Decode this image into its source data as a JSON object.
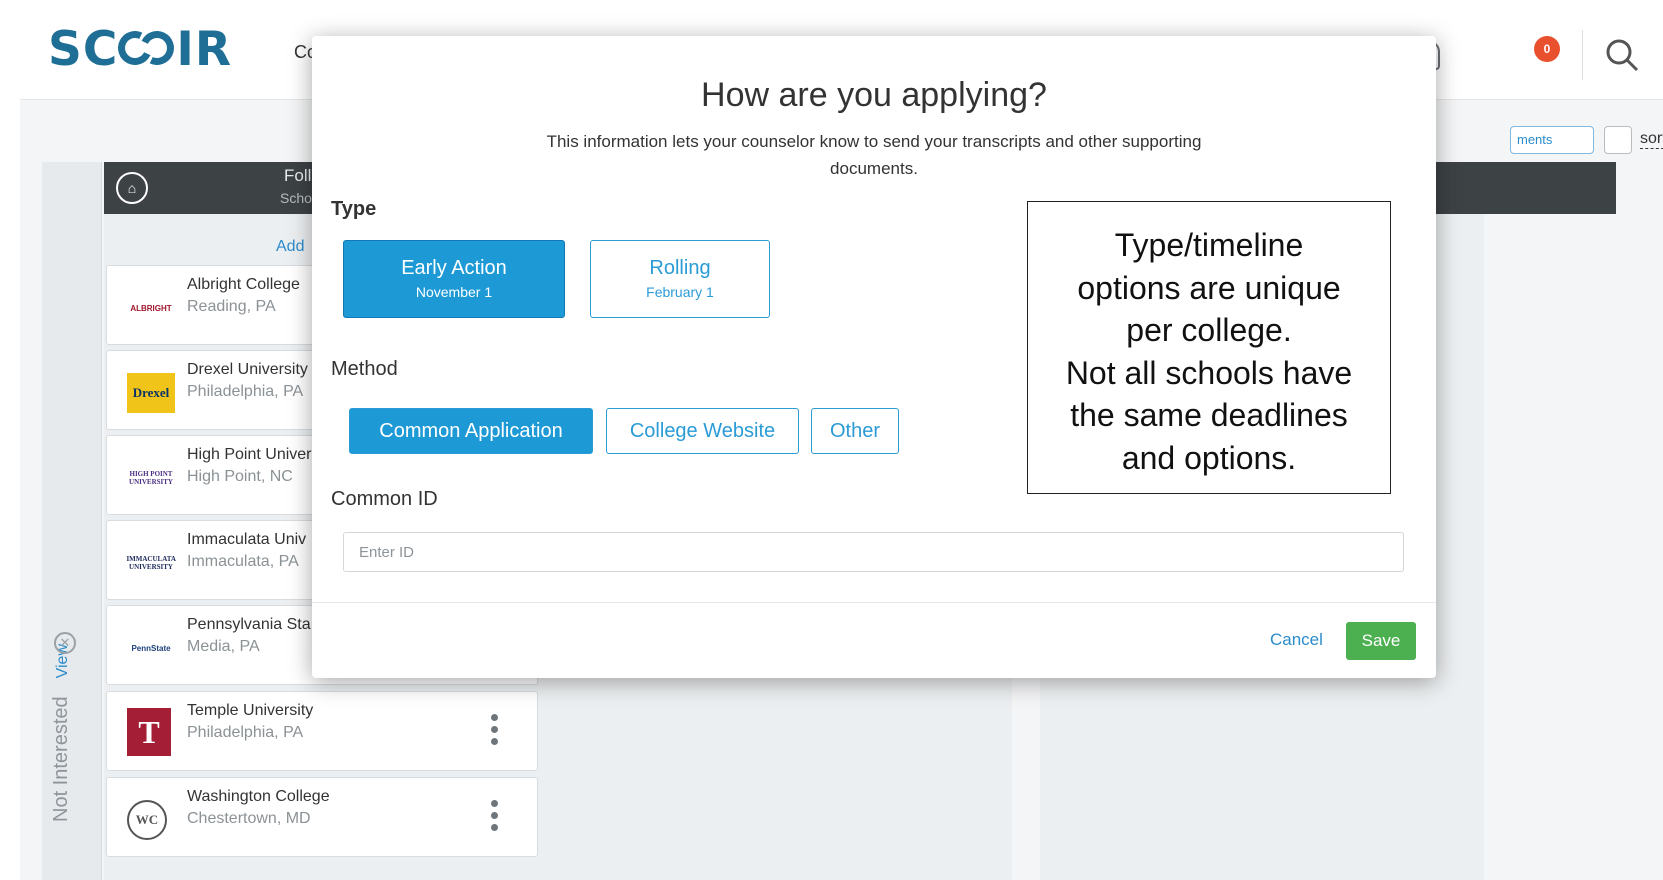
{
  "nav": {
    "logo_text": "SCOIR",
    "college_label": "Coll",
    "notification_count": "0"
  },
  "toolbar": {
    "ments_label": "ments",
    "sort_label": "sort b"
  },
  "sidebar": {
    "label": "Not Interested",
    "view_label": "View"
  },
  "list": {
    "header_title": "Foll",
    "header_sub": "Scho",
    "add_label": "Add",
    "colleges": [
      {
        "name": "Albright College",
        "location": "Reading, PA",
        "logo": "ALBRIGHT"
      },
      {
        "name": "Drexel University",
        "location": "Philadelphia, PA",
        "logo": "Drexel"
      },
      {
        "name": "High Point Univer",
        "location": "High Point, NC",
        "logo": "HIGH POINT UNIVERSITY"
      },
      {
        "name": "Immaculata Univ",
        "location": "Immaculata, PA",
        "logo": "IMMACULATA UNIVERSITY"
      },
      {
        "name": "Pennsylvania Sta",
        "location": "Media, PA",
        "logo": "PennState"
      },
      {
        "name": "Temple University",
        "location": "Philadelphia, PA",
        "logo": "T"
      },
      {
        "name": "Washington College",
        "location": "Chestertown, MD",
        "logo": "WC"
      }
    ]
  },
  "modal": {
    "title": "How are you applying?",
    "description": "This information lets your counselor know to send your transcripts and other supporting documents.",
    "type_label": "Type",
    "types": [
      {
        "label": "Early Action",
        "date": "November 1",
        "selected": true
      },
      {
        "label": "Rolling",
        "date": "February 1",
        "selected": false
      }
    ],
    "method_label": "Method",
    "methods": [
      {
        "label": "Common Application",
        "selected": true
      },
      {
        "label": "College Website",
        "selected": false
      },
      {
        "label": "Other",
        "selected": false
      }
    ],
    "common_id_label": "Common ID",
    "common_id_placeholder": "Enter ID",
    "common_id_value": "",
    "cancel_label": "Cancel",
    "save_label": "Save"
  },
  "annotation": {
    "lines": [
      "Type/timeline",
      "options are unique",
      "per college.",
      "Not all schools have",
      "the same deadlines",
      "and options."
    ]
  },
  "colors": {
    "brand": "#1f6e95",
    "accent": "#1d9ad6",
    "save": "#4caf50",
    "badge": "#e8502e"
  }
}
